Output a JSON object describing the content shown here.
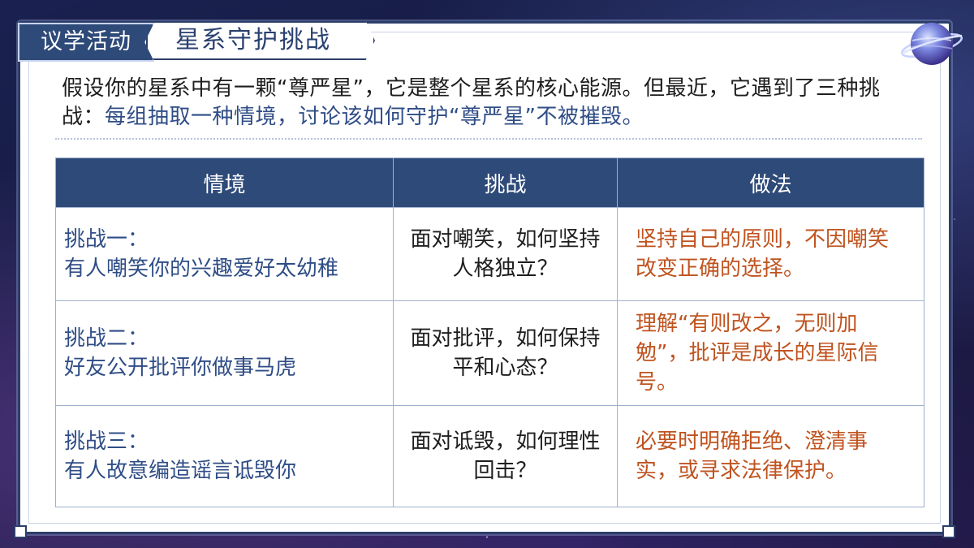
{
  "header": {
    "activity_label": "议学活动",
    "title": "星系守护挑战"
  },
  "intro": {
    "part1": "假设你的星系中有一颗“尊严星”，它是整个星系的核心能源。但最近，它遇到了三种挑战：",
    "part2": "每组抽取一种情境，讨论该如何守护“尊严星”不被摧毁。"
  },
  "table": {
    "headers": [
      "情境",
      "挑战",
      "做法"
    ],
    "rows": [
      {
        "situation_title": "挑战一：",
        "situation_desc": "有人嘲笑你的兴趣爱好太幼稚",
        "challenge": "面对嘲笑，如何坚持人格独立？",
        "method": "坚持自己的原则，不因嘲笑改变正确的选择。"
      },
      {
        "situation_title": "挑战二：",
        "situation_desc": "好友公开批评你做事马虎",
        "challenge": "面对批评，如何保持平和心态？",
        "method": "理解“有则改之，无则加勉”，批评是成长的星际信号。"
      },
      {
        "situation_title": "挑战三：",
        "situation_desc": "有人故意编造谣言诋毁你",
        "challenge": "面对诋毁，如何理性回击？",
        "method": "必要时明确拒绝、澄清事实，或寻求法律保护。"
      }
    ]
  },
  "colors": {
    "navy": "#2e4a78",
    "blue_text": "#2f4d86",
    "orange_text": "#c0531f"
  },
  "icons": {
    "planet": "planet-icon"
  }
}
